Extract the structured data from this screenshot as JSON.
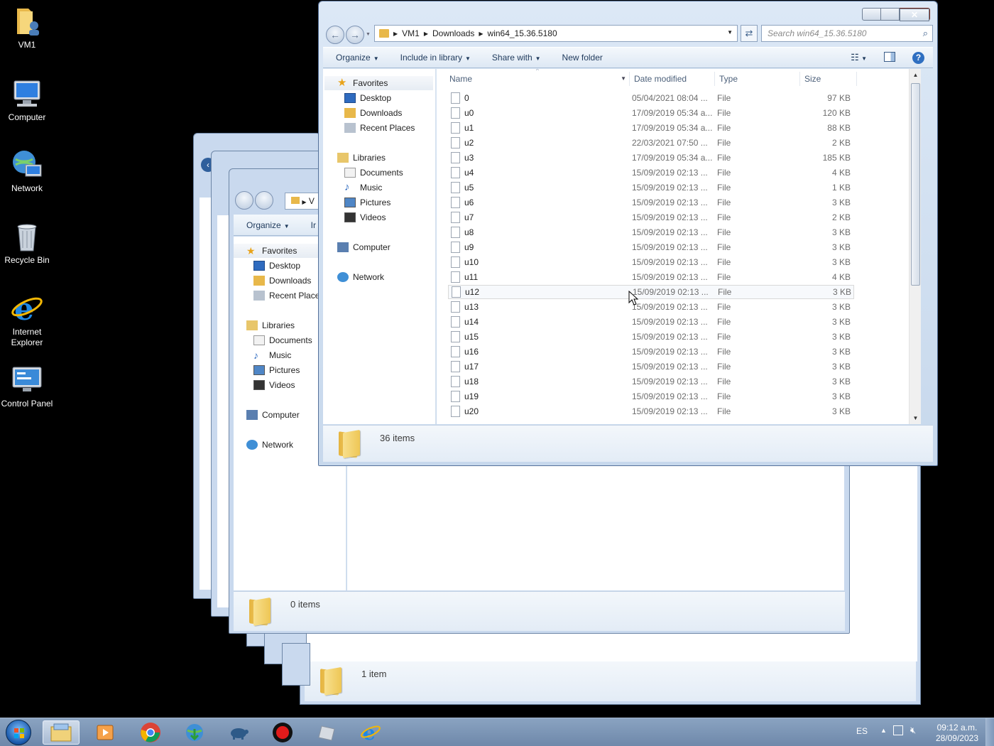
{
  "desktop": {
    "icons": [
      {
        "label": "VM1",
        "icon": "user-folder-icon"
      },
      {
        "label": "Computer",
        "icon": "computer-icon"
      },
      {
        "label": "Network",
        "icon": "network-icon"
      },
      {
        "label": "Recycle Bin",
        "icon": "recycle-bin-icon"
      },
      {
        "label": "Internet Explorer",
        "icon": "internet-explorer-icon"
      },
      {
        "label": "Control Panel",
        "icon": "control-panel-icon"
      }
    ]
  },
  "background_windows": {
    "middle": {
      "toolbar_organize": "Organize",
      "toolbar_partial": "Ir",
      "address_partial": "V",
      "nav": {
        "favorites": "Favorites",
        "desktop": "Desktop",
        "downloads": "Downloads",
        "recent": "Recent Place",
        "libraries": "Libraries",
        "documents": "Documents",
        "music": "Music",
        "pictures": "Pictures",
        "videos": "Videos",
        "computer": "Computer",
        "network": "Network"
      },
      "item_count": "0 items"
    },
    "back": {
      "item_count": "1 item"
    }
  },
  "main_window": {
    "breadcrumb": [
      "VM1",
      "Downloads",
      "win64_15.36.5180"
    ],
    "search_placeholder": "Search win64_15.36.5180",
    "toolbar": {
      "organize": "Organize",
      "include_in_library": "Include in library",
      "share_with": "Share with",
      "new_folder": "New folder"
    },
    "nav": {
      "favorites": "Favorites",
      "desktop": "Desktop",
      "downloads": "Downloads",
      "recent_places": "Recent Places",
      "libraries": "Libraries",
      "documents": "Documents",
      "music": "Music",
      "pictures": "Pictures",
      "videos": "Videos",
      "computer": "Computer",
      "network": "Network"
    },
    "columns": {
      "name": "Name",
      "date": "Date modified",
      "type": "Type",
      "size": "Size"
    },
    "files": [
      {
        "name": "0",
        "date": "05/04/2021 08:04 ...",
        "type": "File",
        "size": "97 KB"
      },
      {
        "name": "u0",
        "date": "17/09/2019 05:34 a...",
        "type": "File",
        "size": "120 KB"
      },
      {
        "name": "u1",
        "date": "17/09/2019 05:34 a...",
        "type": "File",
        "size": "88 KB"
      },
      {
        "name": "u2",
        "date": "22/03/2021 07:50 ...",
        "type": "File",
        "size": "2 KB"
      },
      {
        "name": "u3",
        "date": "17/09/2019 05:34 a...",
        "type": "File",
        "size": "185 KB"
      },
      {
        "name": "u4",
        "date": "15/09/2019 02:13 ...",
        "type": "File",
        "size": "4 KB"
      },
      {
        "name": "u5",
        "date": "15/09/2019 02:13 ...",
        "type": "File",
        "size": "1 KB"
      },
      {
        "name": "u6",
        "date": "15/09/2019 02:13 ...",
        "type": "File",
        "size": "3 KB"
      },
      {
        "name": "u7",
        "date": "15/09/2019 02:13 ...",
        "type": "File",
        "size": "2 KB"
      },
      {
        "name": "u8",
        "date": "15/09/2019 02:13 ...",
        "type": "File",
        "size": "3 KB"
      },
      {
        "name": "u9",
        "date": "15/09/2019 02:13 ...",
        "type": "File",
        "size": "3 KB"
      },
      {
        "name": "u10",
        "date": "15/09/2019 02:13 ...",
        "type": "File",
        "size": "3 KB"
      },
      {
        "name": "u11",
        "date": "15/09/2019 02:13 ...",
        "type": "File",
        "size": "4 KB"
      },
      {
        "name": "u12",
        "date": "15/09/2019 02:13 ...",
        "type": "File",
        "size": "3 KB"
      },
      {
        "name": "u13",
        "date": "15/09/2019 02:13 ...",
        "type": "File",
        "size": "3 KB"
      },
      {
        "name": "u14",
        "date": "15/09/2019 02:13 ...",
        "type": "File",
        "size": "3 KB"
      },
      {
        "name": "u15",
        "date": "15/09/2019 02:13 ...",
        "type": "File",
        "size": "3 KB"
      },
      {
        "name": "u16",
        "date": "15/09/2019 02:13 ...",
        "type": "File",
        "size": "3 KB"
      },
      {
        "name": "u17",
        "date": "15/09/2019 02:13 ...",
        "type": "File",
        "size": "3 KB"
      },
      {
        "name": "u18",
        "date": "15/09/2019 02:13 ...",
        "type": "File",
        "size": "3 KB"
      },
      {
        "name": "u19",
        "date": "15/09/2019 02:13 ...",
        "type": "File",
        "size": "3 KB"
      },
      {
        "name": "u20",
        "date": "15/09/2019 02:13 ...",
        "type": "File",
        "size": "3 KB"
      }
    ],
    "hovered_row": "u12",
    "item_count": "36 items"
  },
  "taskbar": {
    "pinned": [
      "windows-explorer-icon",
      "media-player-icon",
      "chrome-icon",
      "globe-download-icon",
      "turtle-icon",
      "record-icon",
      "generic-app-icon",
      "internet-explorer-icon"
    ],
    "language": "ES",
    "time": "09:12 a.m.",
    "date": "28/09/2023"
  }
}
